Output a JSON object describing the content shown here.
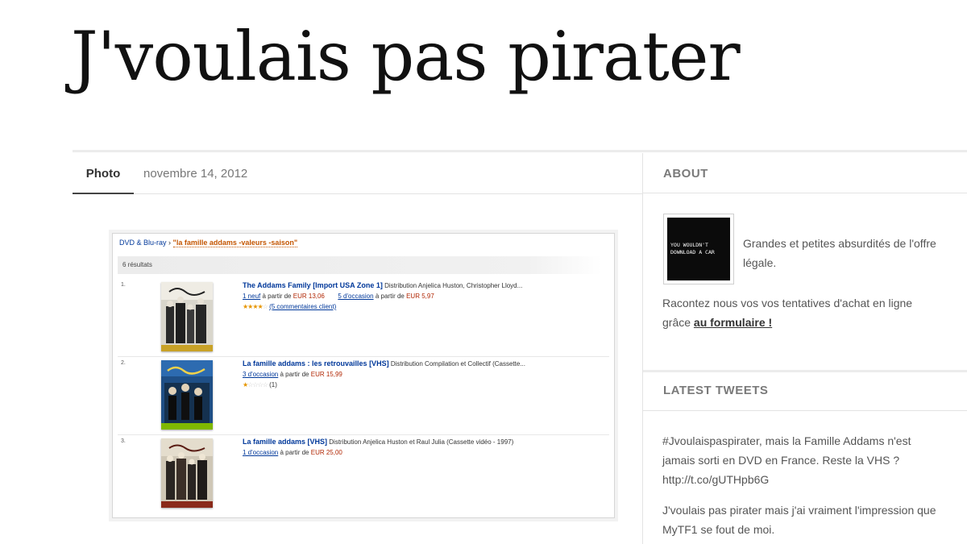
{
  "site": {
    "title": "J'voulais pas pirater"
  },
  "post": {
    "type_tab": "Photo",
    "date": "novembre 14, 2012",
    "screenshot": {
      "breadcrumb_category": "DVD & Blu-ray",
      "breadcrumb_sep": "›",
      "breadcrumb_query": "\"la famille addams -valeurs -saison\"",
      "result_count": "6 résultats",
      "results": [
        {
          "num": "1.",
          "title": "The Addams Family [Import USA Zone 1]",
          "byline": "Distribution Anjelica Huston, Christopher Lloyd...",
          "offer_new_link": "1 neuf",
          "offer_new_text": "à partir de",
          "offer_new_price": "EUR 13,06",
          "offer_used_link": "5 d'occasion",
          "offer_used_text": "à partir de",
          "offer_used_price": "EUR 5,97",
          "stars": "★★★★",
          "stars_off": "☆",
          "reviews": "(5 commentaires client)"
        },
        {
          "num": "2.",
          "title": "La famille addams : les retrouvailles [VHS]",
          "byline": "Distribution Compilation et Collectif (Cassette...",
          "offer_used_link": "3 d'occasion",
          "offer_used_text": "à partir de",
          "offer_used_price": "EUR 15,99",
          "stars": "★",
          "stars_off": "☆☆☆☆",
          "reviews": "(1)"
        },
        {
          "num": "3.",
          "title": "La famille addams [VHS]",
          "byline": "Distribution Anjelica Huston et Raul Julia (Cassette vidéo - 1997)",
          "offer_used_link": "1 d'occasion",
          "offer_used_text": "à partir de",
          "offer_used_price": "EUR 25,00"
        }
      ]
    }
  },
  "sidebar": {
    "about": {
      "heading": "ABOUT",
      "avatar_lines": [
        "YOU WOULDN'T",
        "DOWNLOAD A CAR"
      ],
      "description": "Grandes et petites absurdités de l'offre légale.",
      "cta_text": "Racontez nous vos vos tentatives d'achat en ligne grâce ",
      "cta_link": "au formulaire !"
    },
    "tweets": {
      "heading": "LATEST TWEETS",
      "items": [
        "#Jvoulaispaspirater, mais la Famille Addams n'est jamais sorti en DVD en France. Reste la VHS ? http://t.co/gUTHpb6G",
        "J'voulais pas pirater mais j'ai vraiment l'impression que MyTF1 se fout de moi."
      ]
    }
  },
  "colors": {
    "link_blue": "#00389a",
    "price_red": "#b12704",
    "query_orange": "#c45500"
  }
}
